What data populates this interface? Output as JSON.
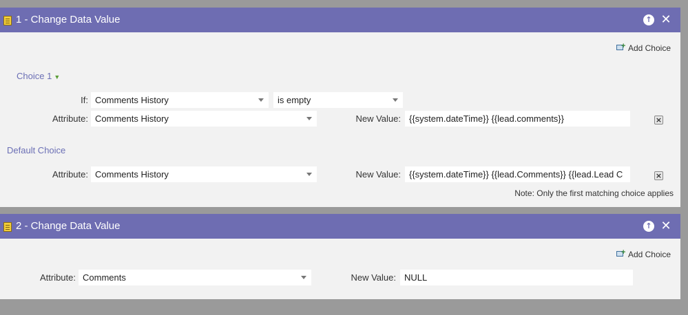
{
  "step1": {
    "title": "1 - Change Data Value",
    "add_choice": "Add Choice",
    "choice1": {
      "label": "Choice 1",
      "if_label": "If:",
      "if_field": "Comments History",
      "if_operator": "is empty",
      "attribute_label": "Attribute:",
      "attribute_value": "Comments History",
      "new_value_label": "New Value:",
      "new_value": "{{system.dateTime}} {{lead.comments}}"
    },
    "default_choice": {
      "label": "Default Choice",
      "attribute_label": "Attribute:",
      "attribute_value": "Comments History",
      "new_value_label": "New Value:",
      "new_value": "{{system.dateTime}} {{lead.Comments}} {{lead.Lead C"
    },
    "note": "Note: Only the first matching choice applies"
  },
  "step2": {
    "title": "2 - Change Data Value",
    "add_choice": "Add Choice",
    "attribute_label": "Attribute:",
    "attribute_value": "Comments",
    "new_value_label": "New Value:",
    "new_value": "NULL"
  },
  "icons": {
    "step": "flow-step-icon",
    "move_up": "arrow-up-circle-icon",
    "close": "close-icon",
    "add_choice": "add-choice-icon",
    "remove": "remove-choice-icon"
  },
  "colors": {
    "header": "#6e6db2",
    "panel": "#f2f2f2",
    "background": "#9a9a9a",
    "choice_label": "#6b6fb5"
  }
}
